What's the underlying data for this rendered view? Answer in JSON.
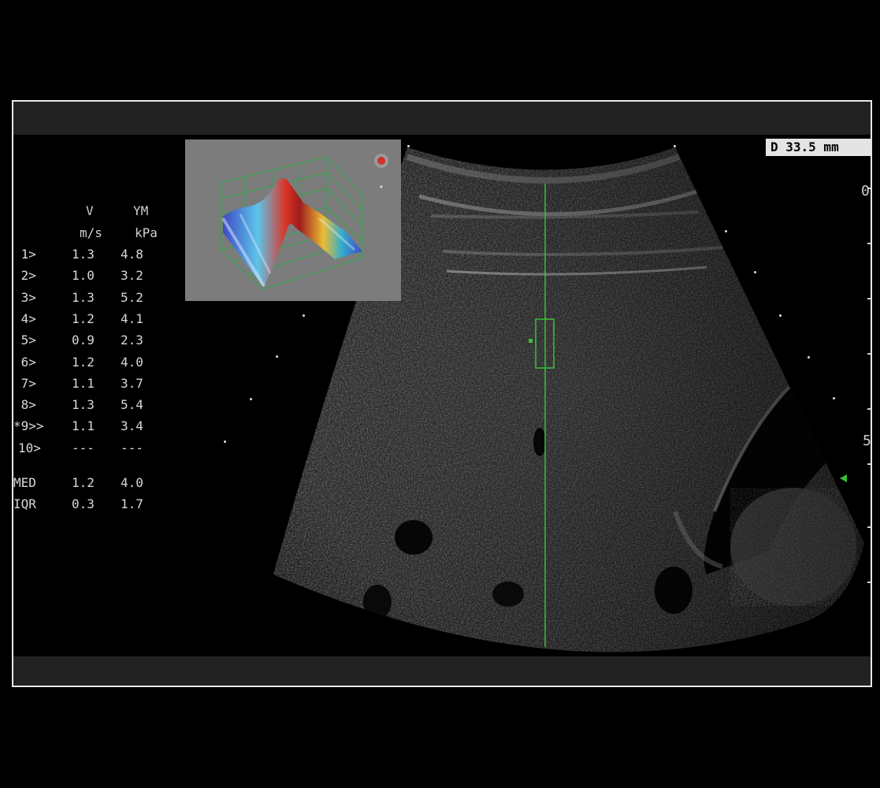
{
  "measurement_table": {
    "header_row1": [
      "V",
      "YM"
    ],
    "header_row2": [
      "m/s",
      "kPa"
    ],
    "rows": [
      {
        "index": " 1>",
        "v": "1.3",
        "ym": "4.8"
      },
      {
        "index": " 2>",
        "v": "1.0",
        "ym": "3.2"
      },
      {
        "index": " 3>",
        "v": "1.3",
        "ym": "5.2"
      },
      {
        "index": " 4>",
        "v": "1.2",
        "ym": "4.1"
      },
      {
        "index": " 5>",
        "v": "0.9",
        "ym": "2.3"
      },
      {
        "index": " 6>",
        "v": "1.2",
        "ym": "4.0"
      },
      {
        "index": " 7>",
        "v": "1.1",
        "ym": "3.7"
      },
      {
        "index": " 8>",
        "v": "1.3",
        "ym": "5.4"
      },
      {
        "index": "*9>>",
        "v": "1.1",
        "ym": "3.4"
      },
      {
        "index": "10>",
        "v": "---",
        "ym": "---"
      }
    ],
    "summary": [
      {
        "label": "MED",
        "v": "1.2",
        "ym": "4.0"
      },
      {
        "label": "IQR",
        "v": "0.3",
        "ym": "1.7"
      }
    ]
  },
  "depth_readout": "D 33.5 mm",
  "depth_scale": [
    "0",
    "5"
  ],
  "colors": {
    "roi": "#38c038",
    "background": "#000000",
    "frame_border": "#e8e8e8",
    "band": "#222222"
  }
}
